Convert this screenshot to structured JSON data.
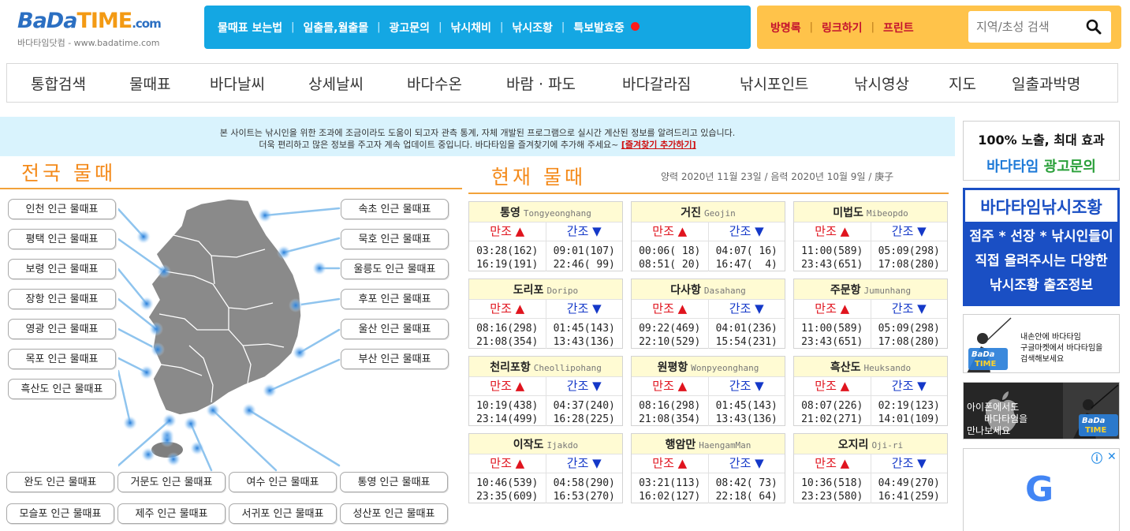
{
  "logo": {
    "bada": "BaDa",
    "time": "TIME",
    "com": ".com",
    "sub": "바다타임닷컴 - www.badatime.com"
  },
  "topnav": [
    "물때표 보는법",
    "일출몰,월출몰",
    "광고문의",
    "낚시채비",
    "낚시조황",
    "특보발효중"
  ],
  "rightnav": [
    "방명록",
    "링크하기",
    "프린트"
  ],
  "search": {
    "placeholder": "지역/초성 검색"
  },
  "mainnav": [
    "통합검색",
    "물때표",
    "바다날씨",
    "상세날씨",
    "바다수온",
    "바람 · 파도",
    "바다갈라짐",
    "낚시포인트",
    "낚시영상",
    "지도",
    "일출과박명"
  ],
  "banner": {
    "line1": "본 사이트는 낚시인을 위한 조과에 조금이라도 도움이 되고자 관측 통계, 자체 개발된 프로그램으로 실시간 계산된 정보를 알려드리고 있습니다.",
    "line2": "더욱 편리하고 많은 정보를 주고자 계속 업데이트 중입니다. 바다타임을 즐겨찾기에 추가해 주세요~",
    "fav": "[즐겨찾기 추가하기]"
  },
  "map_title": "전국 물때",
  "current_title": "현재 물때",
  "date_text": "양력 2020년 11월 23일 / 음력 2020년 10월 9일 / 庚子",
  "map_buttons": {
    "left": [
      "인천 인근 물때표",
      "평택 인근 물때표",
      "보령 인근 물때표",
      "장항 인근 물때표",
      "영광 인근 물때표",
      "목포 인근 물때표",
      "흑산도 인근 물때표"
    ],
    "right": [
      "속초 인근 물때표",
      "묵호 인근 물때표",
      "울릉도 인근 물때표",
      "후포 인근 물때표",
      "울산 인근 물때표",
      "부산 인근 물때표"
    ],
    "bottom1": [
      "완도 인근 물때표",
      "거문도 인근 물때표",
      "여수 인근 물때표",
      "통영 인근 물때표"
    ],
    "bottom2": [
      "모슬포 인근 물때표",
      "제주 인근 물때표",
      "서귀포 인근 물때표",
      "성산포 인근 물때표"
    ]
  },
  "tide_labels": {
    "high": "만조",
    "low": "간조",
    "high_arrow": "▲",
    "low_arrow": "▼"
  },
  "stations": [
    {
      "ko": "통영",
      "en": "Tongyeonghang",
      "high": "03:28(162)\n16:19(191)",
      "low": "09:01(107)\n22:46( 99)"
    },
    {
      "ko": "거진",
      "en": "Geojin",
      "high": "00:06( 18)\n08:51( 20)",
      "low": "04:07( 16)\n16:47(  4)"
    },
    {
      "ko": "미법도",
      "en": "Mibeopdo",
      "high": "11:00(589)\n23:43(651)",
      "low": "05:09(298)\n17:08(280)"
    },
    {
      "ko": "도리포",
      "en": "Doripo",
      "high": "08:16(298)\n21:08(354)",
      "low": "01:45(143)\n13:43(136)"
    },
    {
      "ko": "다사항",
      "en": "Dasahang",
      "high": "09:22(469)\n22:10(529)",
      "low": "04:01(236)\n15:54(231)"
    },
    {
      "ko": "주문항",
      "en": "Jumunhang",
      "high": "11:00(589)\n23:43(651)",
      "low": "05:09(298)\n17:08(280)"
    },
    {
      "ko": "천리포항",
      "en": "Cheollipohang",
      "high": "10:19(438)\n23:14(499)",
      "low": "04:37(240)\n16:28(225)"
    },
    {
      "ko": "원평항",
      "en": "Wonpyeonghang",
      "high": "08:16(298)\n21:08(354)",
      "low": "01:45(143)\n13:43(136)"
    },
    {
      "ko": "흑산도",
      "en": "Heuksando",
      "high": "08:07(226)\n21:02(271)",
      "low": "02:19(123)\n14:01(109)"
    },
    {
      "ko": "이작도",
      "en": "Ijakdo",
      "high": "10:46(539)\n23:35(609)",
      "low": "04:58(290)\n16:53(270)"
    },
    {
      "ko": "행암만",
      "en": "HaengamMan",
      "high": "03:21(113)\n16:02(127)",
      "low": "08:42( 73)\n22:18( 64)"
    },
    {
      "ko": "오지리",
      "en": "Oji-ri",
      "high": "10:36(518)\n23:23(580)",
      "low": "04:49(270)\n16:41(259)"
    }
  ],
  "ads": {
    "ad1_line1": "100% 노출, 최대 효과",
    "ad1_line2a": "바다타임",
    "ad1_line2b": "광고문의",
    "ad2_title": "바다타임낚시조황",
    "ad2_l1": "점주 * 선장 * 낚시인들이",
    "ad2_l2": "직접 올려주시는 다양한",
    "ad2_l3": "낚시조황 출조정보",
    "ad3_l1": "내손안에 바다타임",
    "ad3_l2": "구글마켓에서 바다타임을",
    "ad3_l3": "검색해보세요",
    "ad4_l1": "아이폰에서도",
    "ad4_l2": "바다타임을",
    "ad4_l3": "만나보세요",
    "badge_bada": "BaDa",
    "badge_time": "TIME",
    "google_letter": "G"
  },
  "colors": {
    "accent_blue": "#14a7e3",
    "accent_yellow": "#ffc34a",
    "title_orange": "#f48a1a",
    "high_red": "#e0141e",
    "low_blue": "#1438c8"
  }
}
